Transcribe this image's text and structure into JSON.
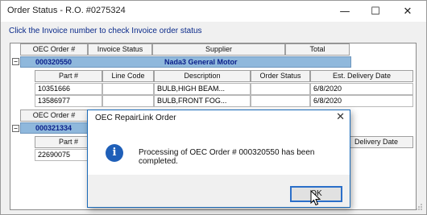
{
  "window": {
    "title": "Order Status - R.O. #0275324",
    "minimize_glyph": "—",
    "maximize_glyph": "☐",
    "close_glyph": "✕"
  },
  "instruction": "Click the Invoice number to check Invoice order status",
  "order_grid": {
    "columns": [
      "OEC Order #",
      "Invoice Status",
      "Supplier",
      "Total"
    ],
    "orders": [
      {
        "order_number": "000320550",
        "supplier": "Nada3 General Motor",
        "expander": "−",
        "part_columns": [
          "Part #",
          "Line Code",
          "Description",
          "Order Status",
          "Est. Delivery Date"
        ],
        "parts": [
          {
            "part": "10351666",
            "line_code": "",
            "description": "BULB,HIGH BEAM...",
            "order_status": "",
            "delivery": "6/8/2020"
          },
          {
            "part": "13586977",
            "line_code": "",
            "description": "BULB,FRONT FOG...",
            "order_status": "",
            "delivery": "6/8/2020"
          }
        ]
      },
      {
        "order_number": "000321334",
        "supplier": "",
        "expander": "−",
        "header_label": "OEC Order #",
        "part_columns": [
          "Part #",
          "Delivery Date"
        ],
        "parts": [
          {
            "part": "22690075"
          }
        ]
      }
    ]
  },
  "dialog": {
    "title": "OEC RepairLink Order",
    "close_glyph": "✕",
    "icon": "info-icon",
    "icon_glyph": "i",
    "message": "Processing of OEC Order # 000320550 has been completed.",
    "ok_label": "OK"
  },
  "colors": {
    "order_row_bg": "#8fb8dc",
    "order_text": "#0a1f8a",
    "instruction_text": "#0a2a8a",
    "info_icon": "#1f5fb8",
    "dialog_border": "#1a6ab8"
  }
}
